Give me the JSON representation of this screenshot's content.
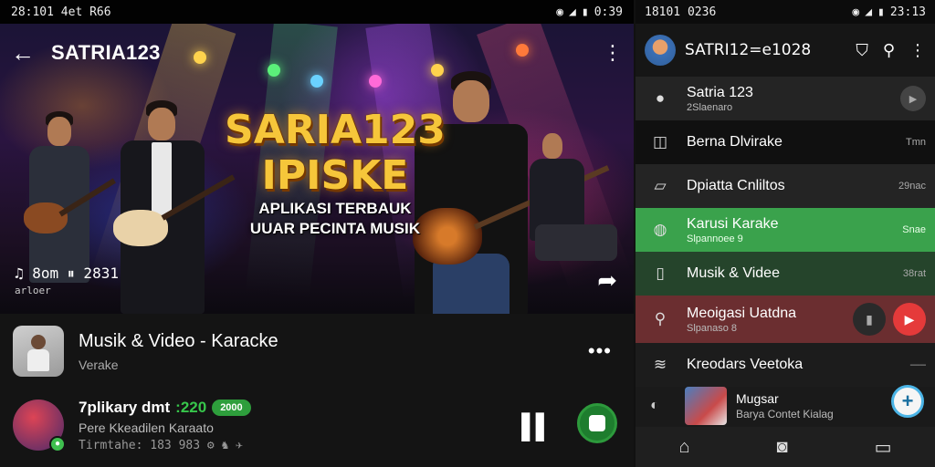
{
  "left": {
    "status": {
      "time_left": "28:101 4et R66",
      "time_right": "0:39"
    },
    "topbar": {
      "back": "←",
      "title": "SATRIA123",
      "more": "⋮"
    },
    "hero": {
      "headline_line1": "SARIA123",
      "headline_line2": "IPISKE",
      "sub_line1": "APLIKASI TERBAUK",
      "sub_line2": "UUAR PECINTA MUSIK",
      "meta": "♫ 8om ⏸ 2831",
      "meta_small": "arloer",
      "share": "➦"
    },
    "row1": {
      "title": "Musik & Video - Karacke",
      "subtitle": "Verake",
      "more": "•••"
    },
    "row2": {
      "title": "7plikary dmt",
      "number": ":220",
      "pill": "2000",
      "subtitle": "Pere Kkeadilen Karaato",
      "meta": "Tirmtahe: 183 983 ⚙ ♞ ✈",
      "pause": "▌▌"
    }
  },
  "right": {
    "status": {
      "time_left": "18101 0236",
      "time_right": "23:13"
    },
    "header": {
      "name": "SATRI12=e1028"
    },
    "menu": [
      {
        "icon": "user",
        "title": "Satria 123",
        "sub": "2Slaenaro",
        "right": "▶"
      },
      {
        "icon": "record",
        "title": "Berna Dlvirake",
        "sub": "",
        "right": "Tmn"
      },
      {
        "icon": "chat",
        "title": "Dpiatta Cnliltos",
        "sub": "",
        "right": "29nac"
      },
      {
        "icon": "mic",
        "title": "Karusi Karake",
        "sub": "Slpannoee 9",
        "right": "Snae"
      },
      {
        "icon": "box",
        "title": "Musik & Videe",
        "sub": "",
        "right": "38rat"
      },
      {
        "icon": "search",
        "title": "Meoigasi Uatdna",
        "sub": "Slpanaso 8",
        "right": ""
      },
      {
        "icon": "wifi",
        "title": "Kreodars Veetoka",
        "sub": "",
        "right": "—–"
      }
    ],
    "mini": {
      "title": "Mugsar",
      "sub": "Barya Contet Kialag"
    },
    "fab": "+"
  }
}
